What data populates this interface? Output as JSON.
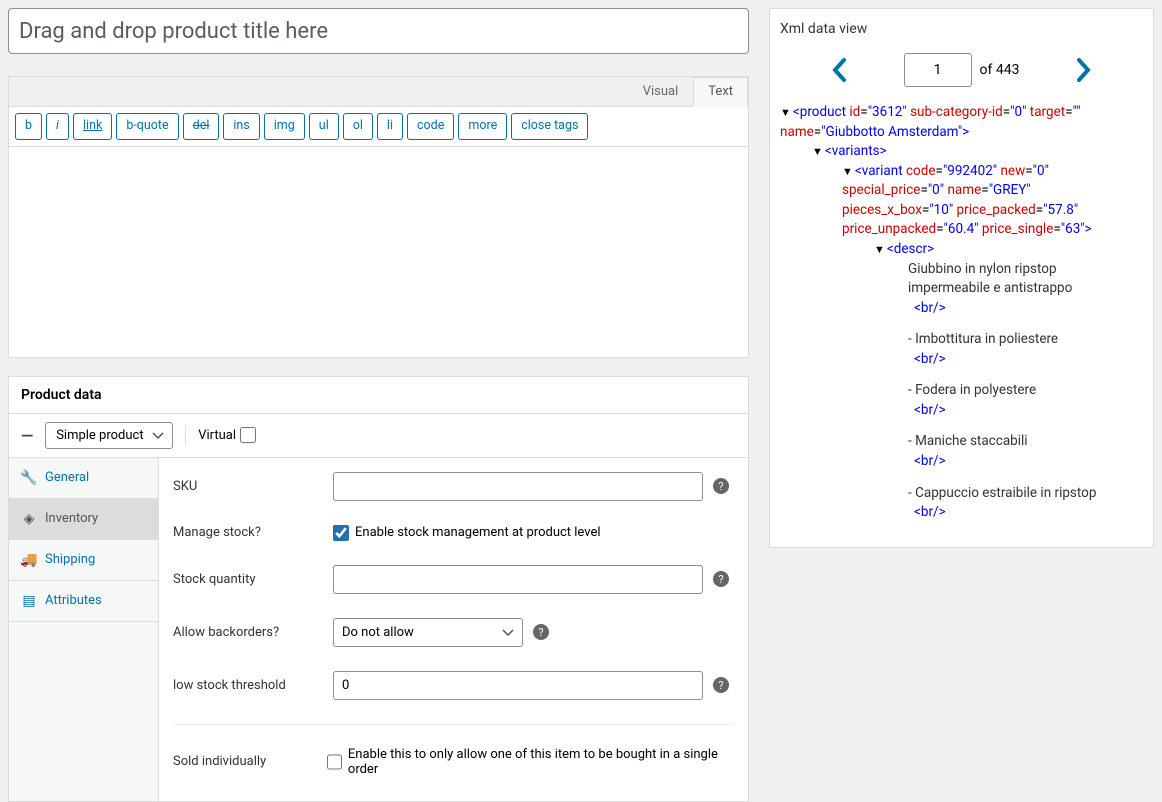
{
  "title_placeholder": "Drag and drop product title here",
  "editor": {
    "tabs": {
      "visual": "Visual",
      "text": "Text",
      "active": "text"
    },
    "buttons": [
      "b",
      "i",
      "link",
      "b-quote",
      "del",
      "ins",
      "img",
      "ul",
      "ol",
      "li",
      "code",
      "more",
      "close tags"
    ]
  },
  "product_data": {
    "header": "Product data",
    "type_selected": "Simple product",
    "virtual_label": "Virtual",
    "virtual_checked": false,
    "tabs": [
      {
        "name": "general",
        "label": "General",
        "active": false,
        "highlight": "link"
      },
      {
        "name": "inventory",
        "label": "Inventory",
        "active": true
      },
      {
        "name": "shipping",
        "label": "Shipping",
        "active": false
      },
      {
        "name": "attributes",
        "label": "Attributes",
        "active": false
      }
    ],
    "fields": {
      "sku": {
        "label": "SKU",
        "value": ""
      },
      "manage_stock": {
        "label": "Manage stock?",
        "desc": "Enable stock management at product level",
        "checked": true
      },
      "stock_quantity": {
        "label": "Stock quantity",
        "value": ""
      },
      "allow_backorders": {
        "label": "Allow backorders?",
        "selected": "Do not allow"
      },
      "low_stock_threshold": {
        "label": "low stock threshold",
        "value": "0"
      },
      "sold_individually": {
        "label": "Sold individually",
        "desc": "Enable this to only allow one of this item to be bought in a single order",
        "checked": false
      }
    }
  },
  "xml": {
    "title": "Xml data view",
    "page_current": "1",
    "page_of_label": "of 443",
    "root": {
      "tag": "product",
      "attrs": {
        "id": "3612",
        "sub-category-id": "0",
        "target": "",
        "name": "Giubbotto Amsterdam"
      }
    },
    "variants_tag": "variants",
    "variant": {
      "tag": "variant",
      "attrs": {
        "code": "992402",
        "new": "0",
        "special_price": "0",
        "name": "GREY",
        "pieces_x_box": "10",
        "price_packed": "57.8",
        "price_unpacked": "60.4",
        "price_single": "63"
      }
    },
    "descr_tag": "descr",
    "desc_lines": [
      "Giubbino in nylon ripstop impermeabile e antistrappo",
      "- Imbottitura in poliestere",
      "- Fodera in polyestere",
      "- Maniche staccabili",
      "- Cappuccio estraibile in ripstop"
    ],
    "br_tag": "<br/>"
  }
}
